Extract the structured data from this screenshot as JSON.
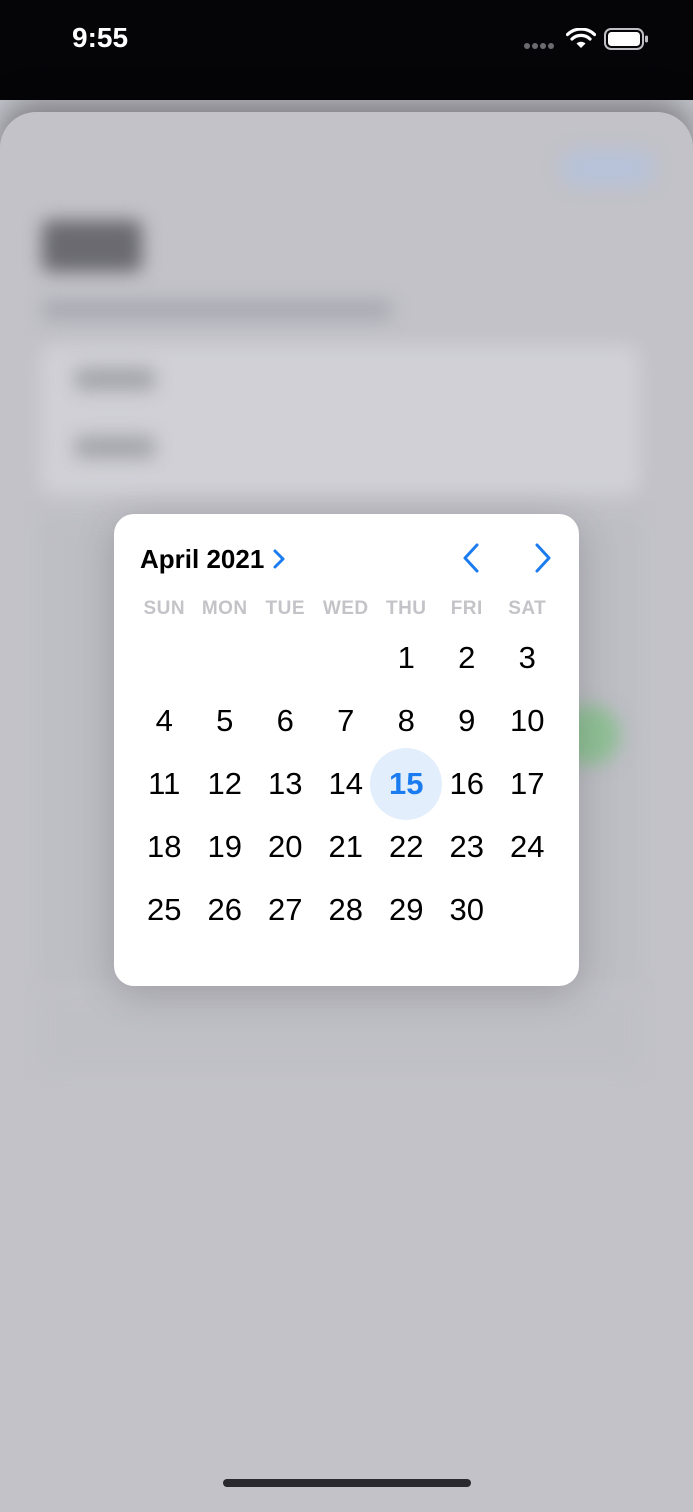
{
  "status_bar": {
    "time": "9:55"
  },
  "calendar": {
    "month_label": "April 2021",
    "weekdays": [
      "SUN",
      "MON",
      "TUE",
      "WED",
      "THU",
      "FRI",
      "SAT"
    ],
    "days": [
      [
        "",
        "",
        "",
        "",
        "1",
        "2",
        "3"
      ],
      [
        "4",
        "5",
        "6",
        "7",
        "8",
        "9",
        "10"
      ],
      [
        "11",
        "12",
        "13",
        "14",
        "15",
        "16",
        "17"
      ],
      [
        "18",
        "19",
        "20",
        "21",
        "22",
        "23",
        "24"
      ],
      [
        "25",
        "26",
        "27",
        "28",
        "29",
        "30",
        ""
      ]
    ],
    "selected_day": "15",
    "accent_color": "#1a7cf0",
    "icons": {
      "month_expand": "chevron-right-icon",
      "previous": "chevron-left-icon",
      "next": "chevron-right-icon"
    }
  }
}
